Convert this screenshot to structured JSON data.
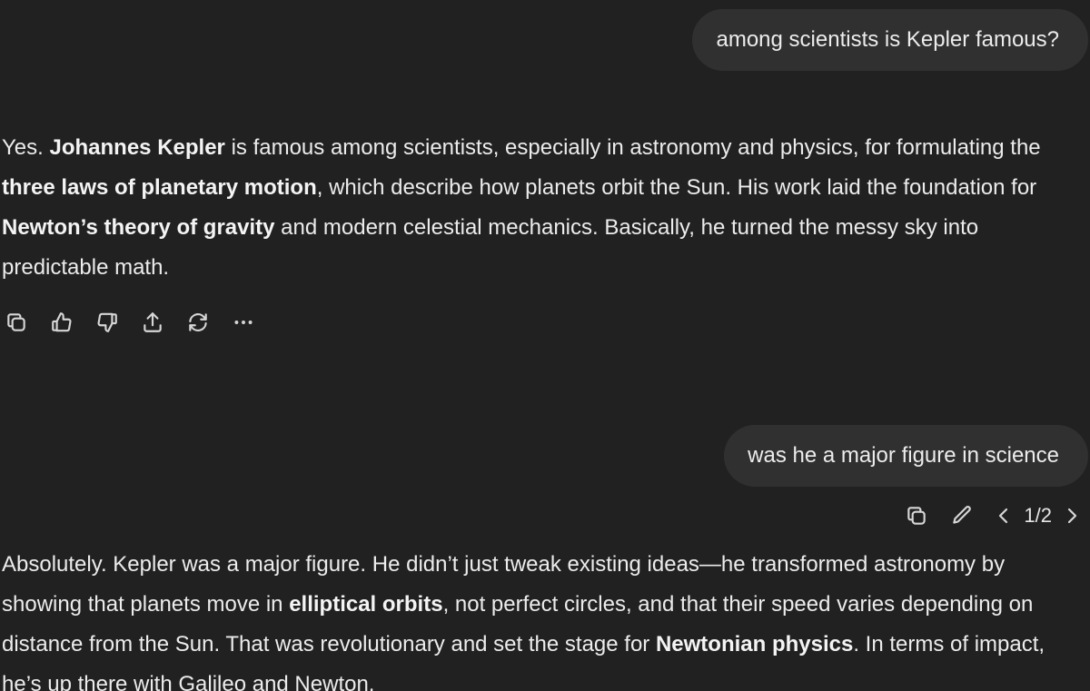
{
  "conversation": {
    "turn1": {
      "user": "among scientists is Kepler famous?",
      "assistant": [
        {
          "t": "Yes. "
        },
        {
          "t": "Johannes Kepler",
          "b": true
        },
        {
          "t": " is famous among scientists, especially in astronomy and physics, for formulating the "
        },
        {
          "t": "three laws of planetary motion",
          "b": true
        },
        {
          "t": ", which describe how planets orbit the Sun. His work laid the foundation for "
        },
        {
          "t": "Newton’s theory of gravity",
          "b": true
        },
        {
          "t": " and modern celestial mechanics. Basically, he turned the messy sky into predictable math."
        }
      ],
      "actions": [
        {
          "name": "copy-icon"
        },
        {
          "name": "thumbs-up-icon"
        },
        {
          "name": "thumbs-down-icon"
        },
        {
          "name": "share-icon"
        },
        {
          "name": "regenerate-icon"
        },
        {
          "name": "more-icon"
        }
      ]
    },
    "turn2": {
      "user": "was he a major figure in science",
      "user_actions": [
        {
          "name": "copy-icon"
        },
        {
          "name": "edit-icon"
        }
      ],
      "pager": "1/2",
      "assistant": [
        {
          "t": "Absolutely. Kepler was a major figure. He didn’t just tweak existing ideas—he transformed astronomy by showing that planets move in "
        },
        {
          "t": "elliptical orbits",
          "b": true
        },
        {
          "t": ", not perfect circles, and that their speed varies depending on distance from the Sun. That was revolutionary and set the stage for "
        },
        {
          "t": "Newtonian physics",
          "b": true
        },
        {
          "t": ". In terms of impact, he’s up there with Galileo and Newton."
        }
      ]
    }
  }
}
